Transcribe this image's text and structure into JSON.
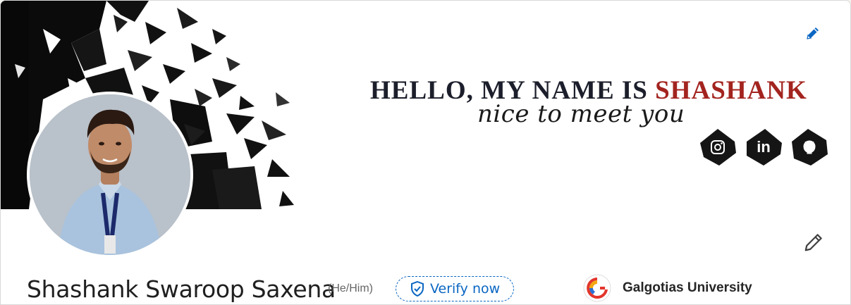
{
  "banner": {
    "headline_prefix": "HELLO, MY NAME IS ",
    "headline_name": "SHASHANK",
    "tagline": "nice to meet you",
    "social": [
      {
        "name": "instagram",
        "glyph": "◎"
      },
      {
        "name": "linkedin",
        "glyph": "in"
      },
      {
        "name": "github",
        "glyph": "🐈"
      }
    ],
    "colors": {
      "dark": "#1c1f2b",
      "accent": "#a3241f",
      "black": "#0b0b0b"
    }
  },
  "profile": {
    "name": "Shashank Swaroop Saxena",
    "pronouns": "(He/Him)",
    "verify_label": "Verify now",
    "education": "Galgotias University",
    "accent_color": "#0a66c2"
  },
  "icons": {
    "edit_banner": "pencil-icon",
    "edit_profile": "pencil-icon",
    "verify": "shield-check-icon"
  }
}
